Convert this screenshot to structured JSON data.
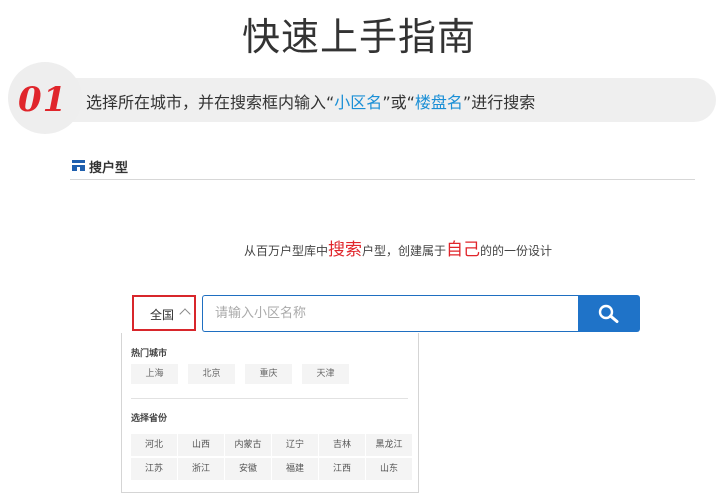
{
  "page": {
    "title": "快速上手指南"
  },
  "step": {
    "number": "01",
    "text_before": "选择所在城市，并在搜索框内输入“",
    "keyword1": "小区名",
    "text_middle": "”或“",
    "keyword2": "楼盘名",
    "text_after": "”进行搜索",
    "highlight_color": "#1a8fd6"
  },
  "section": {
    "icon": "house-plan-icon",
    "label": "搜户型"
  },
  "subtitle": {
    "part1": "从百万户型库中",
    "emph1": "搜索",
    "part2": "户型，创建属于",
    "emph2": "自己",
    "part3": "的的一份设计",
    "emph_color": "#e0252b"
  },
  "search": {
    "city_selected": "全国",
    "placeholder": "请输入小区名称",
    "value": "",
    "button_icon": "search-icon",
    "button_color": "#1f73c8"
  },
  "dropdown": {
    "hot_label": "热门城市",
    "hot_cities": [
      "上海",
      "北京",
      "重庆",
      "天津"
    ],
    "province_label": "选择省份",
    "provinces": [
      "河北",
      "山西",
      "内蒙古",
      "辽宁",
      "吉林",
      "黑龙江",
      "江苏",
      "浙江",
      "安徽",
      "福建",
      "江西",
      "山东"
    ]
  }
}
